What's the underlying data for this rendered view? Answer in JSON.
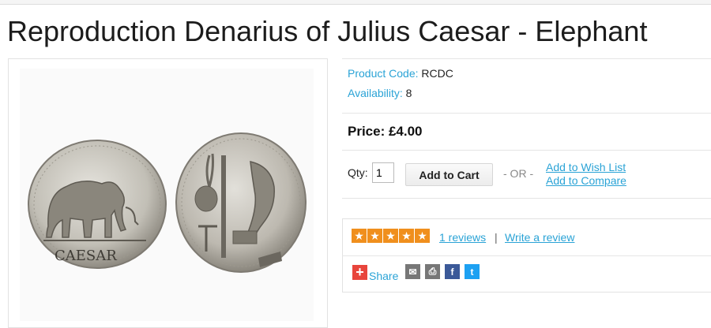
{
  "product": {
    "title": "Reproduction Denarius of Julius Caesar - Elephant",
    "image_inscription": "CAESAR",
    "code_label": "Product Code:",
    "code_value": "RCDC",
    "availability_label": "Availability:",
    "availability_value": "8",
    "price": "Price: £4.00"
  },
  "purchase": {
    "qty_label": "Qty:",
    "qty_value": "1",
    "add_to_cart": "Add to Cart",
    "or_text": "- OR -",
    "wish_list": "Add to Wish List",
    "compare": "Add to Compare"
  },
  "reviews": {
    "rating": 5,
    "rating_max": 5,
    "count_link": "1 reviews",
    "separator": "|",
    "write_link": "Write a review"
  },
  "share": {
    "label": "Share",
    "icons": [
      "share-plus-icon",
      "email-icon",
      "print-icon",
      "facebook-icon",
      "twitter-icon"
    ]
  },
  "colors": {
    "link": "#2aa3d6",
    "star": "#f08f1d",
    "share_plus": "#e8453c",
    "facebook": "#3b5998",
    "twitter": "#1da1f2"
  }
}
